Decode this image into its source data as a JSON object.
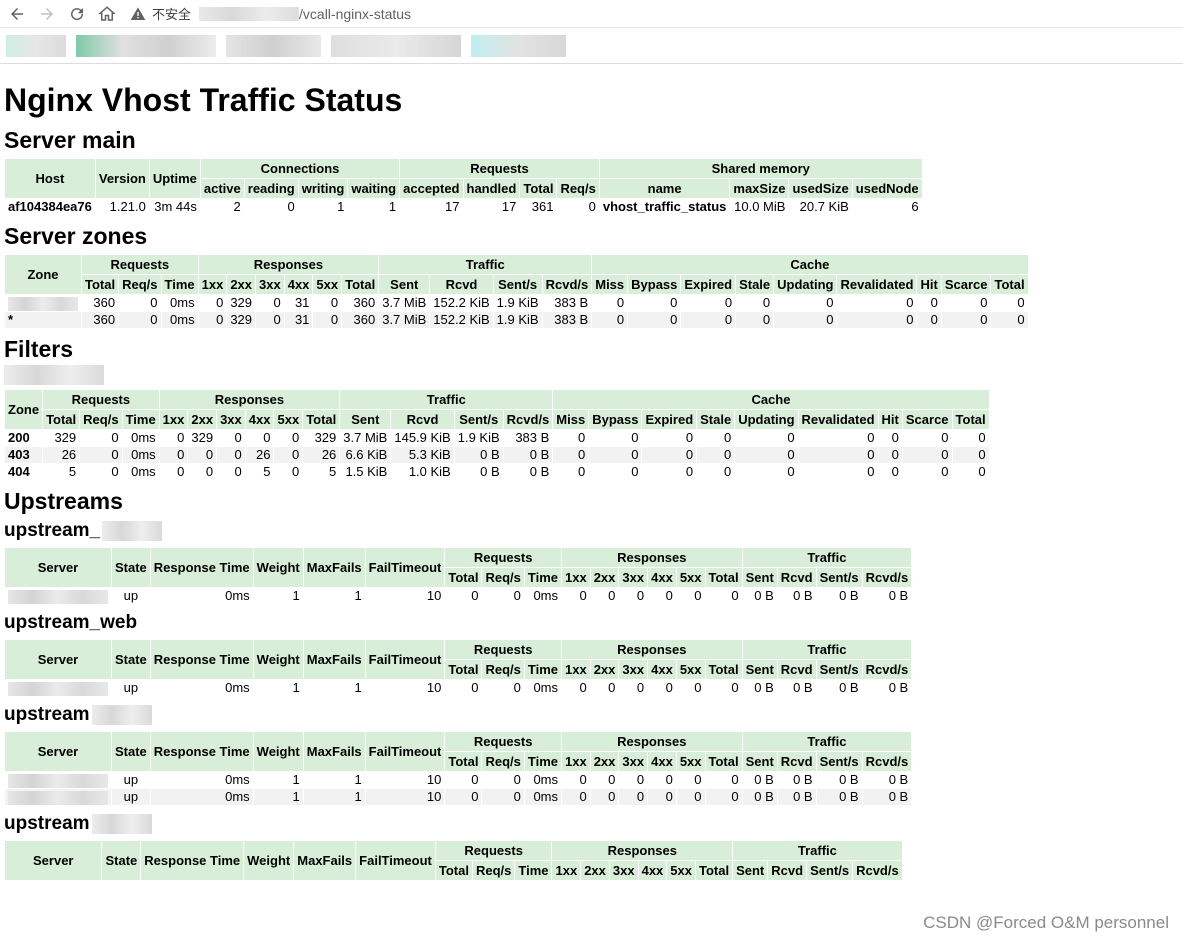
{
  "browser": {
    "insecure_label": "不安全",
    "url_path": "/vcall-nginx-status"
  },
  "page": {
    "title": "Nginx Vhost Traffic Status"
  },
  "server_main": {
    "heading": "Server main",
    "headers": {
      "host": "Host",
      "version": "Version",
      "uptime": "Uptime",
      "connections": "Connections",
      "requests": "Requests",
      "shared_memory": "Shared memory",
      "active": "active",
      "reading": "reading",
      "writing": "writing",
      "waiting": "waiting",
      "accepted": "accepted",
      "handled": "handled",
      "total": "Total",
      "req_s": "Req/s",
      "name": "name",
      "max_size": "maxSize",
      "used_size": "usedSize",
      "used_node": "usedNode"
    },
    "row": {
      "host": "af104384ea76",
      "version": "1.21.0",
      "uptime": "3m 44s",
      "active": "2",
      "reading": "0",
      "writing": "1",
      "waiting": "1",
      "accepted": "17",
      "handled": "17",
      "total": "361",
      "req_s": "0",
      "name": "vhost_traffic_status",
      "max_size": "10.0 MiB",
      "used_size": "20.7 KiB",
      "used_node": "6"
    }
  },
  "zone_headers": {
    "zone": "Zone",
    "requests": "Requests",
    "responses": "Responses",
    "traffic": "Traffic",
    "cache": "Cache",
    "total": "Total",
    "req_s": "Req/s",
    "time": "Time",
    "r1xx": "1xx",
    "r2xx": "2xx",
    "r3xx": "3xx",
    "r4xx": "4xx",
    "r5xx": "5xx",
    "sent": "Sent",
    "rcvd": "Rcvd",
    "sent_s": "Sent/s",
    "rcvd_s": "Rcvd/s",
    "miss": "Miss",
    "bypass": "Bypass",
    "expired": "Expired",
    "stale": "Stale",
    "updating": "Updating",
    "revalidated": "Revalidated",
    "hit": "Hit",
    "scarce": "Scarce"
  },
  "server_zones": {
    "heading": "Server zones",
    "rows": [
      {
        "zone": "",
        "total": "360",
        "req_s": "0",
        "time": "0ms",
        "r1xx": "0",
        "r2xx": "329",
        "r3xx": "0",
        "r4xx": "31",
        "r5xx": "0",
        "r_total": "360",
        "sent": "3.7 MiB",
        "rcvd": "152.2 KiB",
        "sent_s": "1.9 KiB",
        "rcvd_s": "383 B",
        "miss": "0",
        "bypass": "0",
        "expired": "0",
        "stale": "0",
        "updating": "0",
        "revalidated": "0",
        "hit": "0",
        "scarce": "0",
        "c_total": "0"
      },
      {
        "zone": "*",
        "total": "360",
        "req_s": "0",
        "time": "0ms",
        "r1xx": "0",
        "r2xx": "329",
        "r3xx": "0",
        "r4xx": "31",
        "r5xx": "0",
        "r_total": "360",
        "sent": "3.7 MiB",
        "rcvd": "152.2 KiB",
        "sent_s": "1.9 KiB",
        "rcvd_s": "383 B",
        "miss": "0",
        "bypass": "0",
        "expired": "0",
        "stale": "0",
        "updating": "0",
        "revalidated": "0",
        "hit": "0",
        "scarce": "0",
        "c_total": "0"
      }
    ]
  },
  "filters": {
    "heading": "Filters",
    "rows": [
      {
        "zone": "200",
        "total": "329",
        "req_s": "0",
        "time": "0ms",
        "r1xx": "0",
        "r2xx": "329",
        "r3xx": "0",
        "r4xx": "0",
        "r5xx": "0",
        "r_total": "329",
        "sent": "3.7 MiB",
        "rcvd": "145.9 KiB",
        "sent_s": "1.9 KiB",
        "rcvd_s": "383 B",
        "miss": "0",
        "bypass": "0",
        "expired": "0",
        "stale": "0",
        "updating": "0",
        "revalidated": "0",
        "hit": "0",
        "scarce": "0",
        "c_total": "0"
      },
      {
        "zone": "403",
        "total": "26",
        "req_s": "0",
        "time": "0ms",
        "r1xx": "0",
        "r2xx": "0",
        "r3xx": "0",
        "r4xx": "26",
        "r5xx": "0",
        "r_total": "26",
        "sent": "6.6 KiB",
        "rcvd": "5.3 KiB",
        "sent_s": "0 B",
        "rcvd_s": "0 B",
        "miss": "0",
        "bypass": "0",
        "expired": "0",
        "stale": "0",
        "updating": "0",
        "revalidated": "0",
        "hit": "0",
        "scarce": "0",
        "c_total": "0"
      },
      {
        "zone": "404",
        "total": "5",
        "req_s": "0",
        "time": "0ms",
        "r1xx": "0",
        "r2xx": "0",
        "r3xx": "0",
        "r4xx": "5",
        "r5xx": "0",
        "r_total": "5",
        "sent": "1.5 KiB",
        "rcvd": "1.0 KiB",
        "sent_s": "0 B",
        "rcvd_s": "0 B",
        "miss": "0",
        "bypass": "0",
        "expired": "0",
        "stale": "0",
        "updating": "0",
        "revalidated": "0",
        "hit": "0",
        "scarce": "0",
        "c_total": "0"
      }
    ]
  },
  "upstreams": {
    "heading": "Upstreams",
    "headers": {
      "server": "Server",
      "state": "State",
      "response_time": "Response Time",
      "weight": "Weight",
      "max_fails": "MaxFails",
      "fail_timeout": "FailTimeout",
      "requests": "Requests",
      "responses": "Responses",
      "traffic": "Traffic",
      "total": "Total",
      "req_s": "Req/s",
      "time": "Time",
      "r1xx": "1xx",
      "r2xx": "2xx",
      "r3xx": "3xx",
      "r4xx": "4xx",
      "r5xx": "5xx",
      "sent": "Sent",
      "rcvd": "Rcvd",
      "sent_s": "Sent/s",
      "rcvd_s": "Rcvd/s"
    },
    "groups": [
      {
        "name": "upstream_",
        "rows": [
          {
            "state": "up",
            "response_time": "0ms",
            "weight": "1",
            "max_fails": "1",
            "fail_timeout": "10",
            "total": "0",
            "req_s": "0",
            "time": "0ms",
            "r1xx": "0",
            "r2xx": "0",
            "r3xx": "0",
            "r4xx": "0",
            "r5xx": "0",
            "r_total": "0",
            "sent": "0 B",
            "rcvd": "0 B",
            "sent_s": "0 B",
            "rcvd_s": "0 B"
          }
        ]
      },
      {
        "name": "upstream_web",
        "rows": [
          {
            "state": "up",
            "response_time": "0ms",
            "weight": "1",
            "max_fails": "1",
            "fail_timeout": "10",
            "total": "0",
            "req_s": "0",
            "time": "0ms",
            "r1xx": "0",
            "r2xx": "0",
            "r3xx": "0",
            "r4xx": "0",
            "r5xx": "0",
            "r_total": "0",
            "sent": "0 B",
            "rcvd": "0 B",
            "sent_s": "0 B",
            "rcvd_s": "0 B"
          }
        ]
      },
      {
        "name": "upstream",
        "rows": [
          {
            "state": "up",
            "response_time": "0ms",
            "weight": "1",
            "max_fails": "1",
            "fail_timeout": "10",
            "total": "0",
            "req_s": "0",
            "time": "0ms",
            "r1xx": "0",
            "r2xx": "0",
            "r3xx": "0",
            "r4xx": "0",
            "r5xx": "0",
            "r_total": "0",
            "sent": "0 B",
            "rcvd": "0 B",
            "sent_s": "0 B",
            "rcvd_s": "0 B"
          },
          {
            "state": "up",
            "response_time": "0ms",
            "weight": "1",
            "max_fails": "1",
            "fail_timeout": "10",
            "total": "0",
            "req_s": "0",
            "time": "0ms",
            "r1xx": "0",
            "r2xx": "0",
            "r3xx": "0",
            "r4xx": "0",
            "r5xx": "0",
            "r_total": "0",
            "sent": "0 B",
            "rcvd": "0 B",
            "sent_s": "0 B",
            "rcvd_s": "0 B"
          }
        ]
      },
      {
        "name": "upstream",
        "rows": []
      }
    ]
  },
  "watermark": "CSDN @Forced O&M personnel"
}
